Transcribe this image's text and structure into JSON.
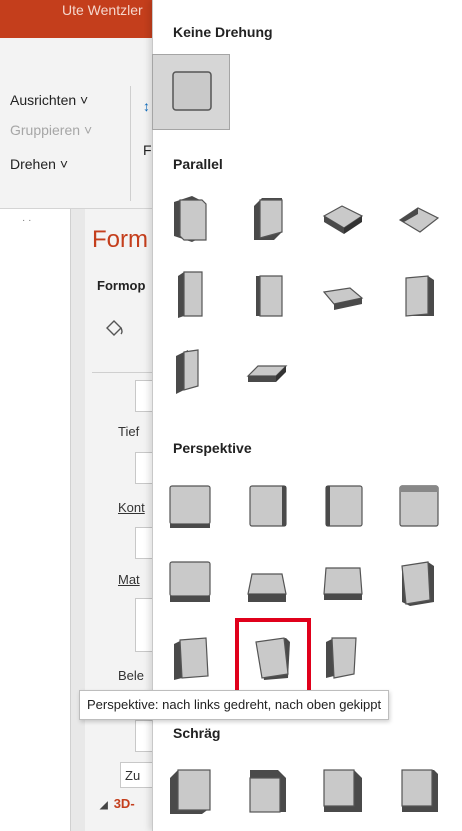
{
  "titlebar": {
    "user": "Ute Wentzler"
  },
  "ribbon": {
    "align": "Ausrichten",
    "group": "Gruppieren",
    "rotate": "Drehen",
    "caret": "˅",
    "frag": "F"
  },
  "pane": {
    "title": "Form",
    "subtitle": "Formop",
    "labels": {
      "depth": "Tief",
      "contour": "Kont",
      "material": "Mat",
      "lighting": "Bele"
    },
    "angle_prefix": "Zu",
    "section_3d": "3D-"
  },
  "gallery": {
    "sections": {
      "no_rotation": "Keine Drehung",
      "parallel": "Parallel",
      "perspective": "Perspektive",
      "oblique": "Schräg"
    }
  },
  "tooltip": {
    "text": "Perspektive: nach links gedreht, nach oben gekippt"
  },
  "colors": {
    "accent": "#c43e1c",
    "highlight": "#e0001b",
    "face": "#c9c9c9",
    "side": "#4a4a4a"
  }
}
